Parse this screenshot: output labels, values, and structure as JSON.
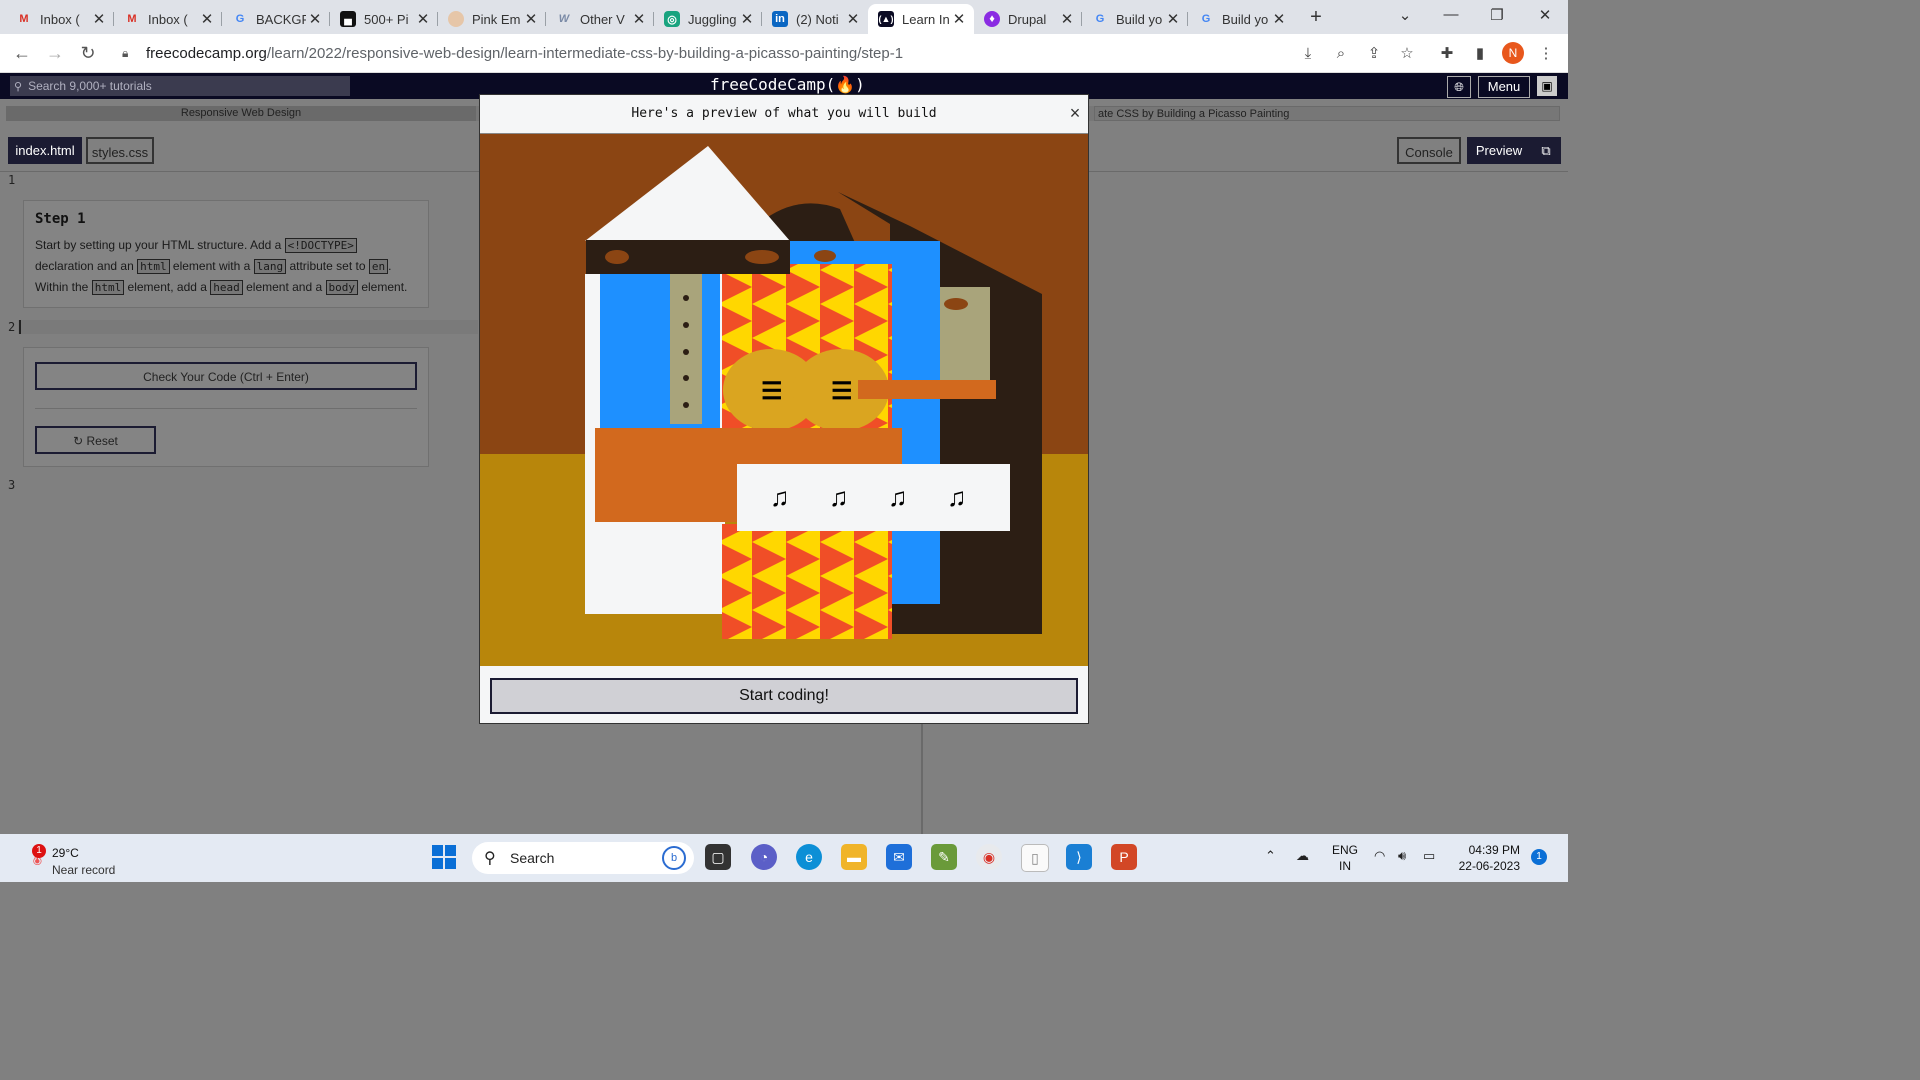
{
  "browser": {
    "tabs": [
      {
        "label": "Inbox (",
        "icon": "gmail-icon",
        "close": "✕"
      },
      {
        "label": "Inbox (",
        "icon": "gmail-icon",
        "close": "✕"
      },
      {
        "label": "BACKGR",
        "icon": "google-icon",
        "close": "✕"
      },
      {
        "label": "500+ Pi",
        "icon": "unsplash-icon",
        "close": "✕"
      },
      {
        "label": "Pink Em",
        "icon": "site-icon",
        "close": "✕"
      },
      {
        "label": "Other V",
        "icon": "w-icon",
        "close": "✕"
      },
      {
        "label": "Juggling",
        "icon": "openai-icon",
        "close": "✕"
      },
      {
        "label": "(2) Noti",
        "icon": "linkedin-icon",
        "close": "✕"
      },
      {
        "label": "Learn In",
        "icon": "freecodecamp-icon",
        "close": "✕"
      },
      {
        "label": "Drupal ",
        "icon": "drupal-icon",
        "close": "✕"
      },
      {
        "label": "Build yo",
        "icon": "google-icon",
        "close": "✕"
      },
      {
        "label": "Build yo",
        "icon": "google-icon",
        "close": "✕"
      }
    ],
    "new_tab": "+",
    "url_host": "freecodecamp.org",
    "url_path": "/learn/2022/responsive-web-design/learn-intermediate-css-by-building-a-picasso-painting/step-1",
    "profile_initial": "N"
  },
  "fcc": {
    "search_placeholder": "Search 9,000+ tutorials",
    "logo": "freeCodeCamp(🔥)",
    "menu": "Menu",
    "breadcrumb_1": "Responsive Web Design",
    "breadcrumb_2": "ate CSS by Building a Picasso Painting",
    "file_tabs": [
      "index.html",
      "styles.css"
    ],
    "console": "Console",
    "preview": "Preview",
    "line_numbers": [
      "1",
      "2",
      "3"
    ],
    "step": {
      "title": "Step 1",
      "t1": "Start by setting up your HTML structure. Add a ",
      "c1": "<!DOCTYPE>",
      "t2": "declaration and an ",
      "c2": "html",
      "t3": " element with a ",
      "c3": "lang",
      "t4": " attribute set to ",
      "c4": "en",
      "t5": ".",
      "t6": "Within the ",
      "c5": "html",
      "t7": " element, add a ",
      "c6": "head",
      "t8": " element and a ",
      "c7": "body",
      "t9": " element."
    },
    "check_button": "Check Your Code (Ctrl + Enter)",
    "reset_button": "Reset"
  },
  "modal": {
    "title": "Here's a preview of what you will build",
    "close": "×",
    "start_button": "Start coding!",
    "guitar_symbol": "☰",
    "note_symbol": "♫"
  },
  "taskbar": {
    "weather_temp": "29°C",
    "weather_desc": "Near record",
    "weather_badge": "1",
    "search": "Search",
    "lang_1": "ENG",
    "lang_2": "IN",
    "time": "04:39 PM",
    "date": "22-06-2023",
    "notifications": "1"
  },
  "colors": {
    "fcc_navy": "#0a0a23",
    "wall": "#8b4513",
    "floor": "#b8860b",
    "blue": "#1e90ff",
    "gold": "#daa520",
    "orange": "#d2691e",
    "red": "#f04e27",
    "yellow": "#ffd700",
    "dark": "#2c1e14"
  }
}
